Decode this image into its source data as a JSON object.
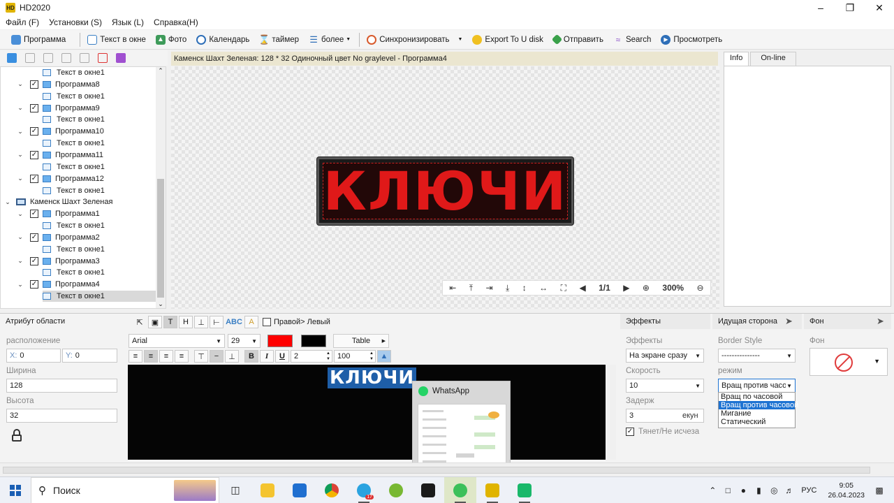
{
  "window": {
    "title": "HD2020",
    "logo_text": "HD"
  },
  "menu": [
    "Файл (F)",
    "Установки (S)",
    "Язык (L)",
    "Справка(H)"
  ],
  "toolbar": {
    "program": "Программа",
    "text_window": "Текст в окне",
    "photo": "Фото",
    "calendar": "Календарь",
    "timer": "таймер",
    "more": "более",
    "sync": "Синхронизировать",
    "export_u_disk": "Export To U disk",
    "send": "Отправить",
    "search": "Search",
    "preview": "Просмотреть"
  },
  "tree": {
    "items": [
      {
        "type": "text",
        "label": "Текст в окне1"
      },
      {
        "type": "program",
        "label": "Программа8"
      },
      {
        "type": "text",
        "label": "Текст в окне1"
      },
      {
        "type": "program",
        "label": "Программа9"
      },
      {
        "type": "text",
        "label": "Текст в окне1"
      },
      {
        "type": "program",
        "label": "Программа10"
      },
      {
        "type": "text",
        "label": "Текст в окне1"
      },
      {
        "type": "program",
        "label": "Программа11"
      },
      {
        "type": "text",
        "label": "Текст в окне1"
      },
      {
        "type": "program",
        "label": "Программа12"
      },
      {
        "type": "text",
        "label": "Текст в окне1"
      },
      {
        "type": "screen",
        "label": "Каменск Шахт Зеленая"
      },
      {
        "type": "program",
        "label": "Программа1"
      },
      {
        "type": "text",
        "label": "Текст в окне1"
      },
      {
        "type": "program",
        "label": "Программа2"
      },
      {
        "type": "text",
        "label": "Текст в окне1"
      },
      {
        "type": "program",
        "label": "Программа3"
      },
      {
        "type": "text",
        "label": "Текст в окне1"
      },
      {
        "type": "program",
        "label": "Программа4"
      },
      {
        "type": "text",
        "label": "Текст в окне1",
        "selected": true
      }
    ]
  },
  "canvas": {
    "header": "Каменск Шахт Зеленая: 128 * 32 Одиночный цвет No graylevel - Программа4",
    "led_text": "КЛЮЧИ",
    "page_indicator": "1/1",
    "zoom": "300%"
  },
  "right_panel": {
    "tabs": [
      "Info",
      "On-line"
    ]
  },
  "area_attr": {
    "title": "Атрибут области",
    "position_label": "расположение",
    "x_prefix": "X:",
    "x_value": "0",
    "y_prefix": "Y:",
    "y_value": "0",
    "width_label": "Ширина",
    "width_value": "128",
    "height_label": "Высота",
    "height_value": "32"
  },
  "text_format": {
    "right_left": "Правой> Левый",
    "font": "Arial",
    "size": "29",
    "table_btn": "Table",
    "spacing": "2",
    "scale": "100",
    "text_color": "#ff0000",
    "bg_color": "#000000",
    "editor_text": "КЛЮЧИ"
  },
  "whatsapp_popup": {
    "title": "WhatsApp"
  },
  "effects": {
    "title": "Эффекты",
    "effects_label": "Эффекты",
    "effects_value": "На экране сразу",
    "speed_label": "Скорость",
    "speed_value": "10",
    "delay_label": "Задерж",
    "delay_value": "3",
    "delay_unit": "екун",
    "drag_label": "Тянет/Не исчеза"
  },
  "border": {
    "title": "Идущая сторона",
    "style_label": "Border Style",
    "style_value": "---------------",
    "mode_label": "режим",
    "mode_value": "Вращ против часов",
    "mode_options": [
      "Вращ по часовой",
      "Вращ против часовой",
      "Мигание",
      "Статический"
    ],
    "mode_highlighted": 1
  },
  "background": {
    "title": "Фон",
    "label": "Фон"
  },
  "taskbar": {
    "search_placeholder": "Поиск",
    "telegram_badge": "17",
    "lang": "РУС",
    "time": "9:05",
    "date": "26.04.2023"
  },
  "colors": {
    "led_red": "#e01919",
    "selection_blue": "#1e73d2",
    "canvas_header_bg": "#ebe6d0"
  }
}
